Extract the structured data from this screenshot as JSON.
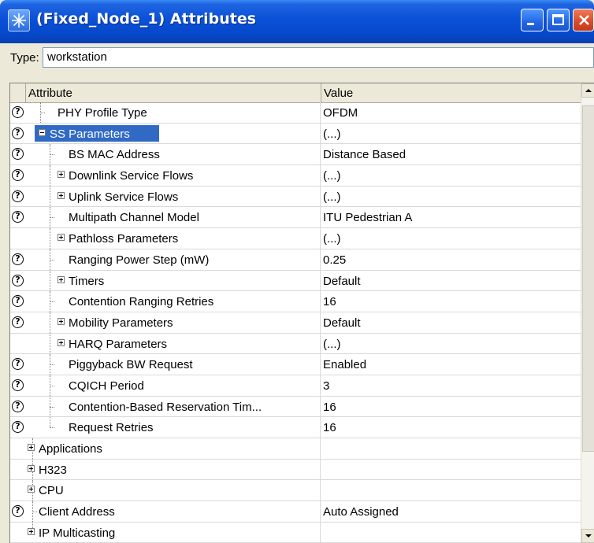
{
  "window": {
    "title": "(Fixed_Node_1) Attributes"
  },
  "type": {
    "label": "Type:",
    "value": "workstation"
  },
  "table": {
    "columns": [
      "Attribute",
      "Value"
    ],
    "rows": [
      {
        "attr": "PHY Profile Type",
        "value": "OFDM",
        "help": true,
        "level": 1,
        "expander": "none"
      },
      {
        "attr": "SS Parameters",
        "value": "(...)",
        "help": true,
        "level": 0,
        "expander": "minus",
        "selected": true
      },
      {
        "attr": "BS MAC Address",
        "value": "Distance Based",
        "help": true,
        "level": 2,
        "expander": "none"
      },
      {
        "attr": "Downlink Service Flows",
        "value": "(...)",
        "help": true,
        "level": 2,
        "expander": "plus"
      },
      {
        "attr": "Uplink Service Flows",
        "value": "(...)",
        "help": true,
        "level": 2,
        "expander": "plus"
      },
      {
        "attr": "Multipath Channel Model",
        "value": "ITU Pedestrian A",
        "help": true,
        "level": 2,
        "expander": "none"
      },
      {
        "attr": "Pathloss Parameters",
        "value": "(...)",
        "help": false,
        "level": 2,
        "expander": "plus"
      },
      {
        "attr": "Ranging Power Step (mW)",
        "value": "0.25",
        "help": true,
        "level": 2,
        "expander": "none"
      },
      {
        "attr": "Timers",
        "value": "Default",
        "help": true,
        "level": 2,
        "expander": "plus"
      },
      {
        "attr": "Contention Ranging Retries",
        "value": "16",
        "help": true,
        "level": 2,
        "expander": "none"
      },
      {
        "attr": "Mobility Parameters",
        "value": "Default",
        "help": true,
        "level": 2,
        "expander": "plus"
      },
      {
        "attr": "HARQ Parameters",
        "value": "(...)",
        "help": false,
        "level": 2,
        "expander": "plus"
      },
      {
        "attr": "Piggyback BW Request",
        "value": "Enabled",
        "help": true,
        "level": 2,
        "expander": "none"
      },
      {
        "attr": "CQICH Period",
        "value": "3",
        "help": true,
        "level": 2,
        "expander": "none"
      },
      {
        "attr": "Contention-Based Reservation Tim...",
        "value": "16",
        "help": true,
        "level": 2,
        "expander": "none"
      },
      {
        "attr": "Request Retries",
        "value": "16",
        "help": true,
        "level": 2,
        "expander": "none"
      },
      {
        "attr": "Applications",
        "value": "",
        "help": false,
        "level": -1,
        "expander": "plus"
      },
      {
        "attr": "H323",
        "value": "",
        "help": false,
        "level": -1,
        "expander": "plus"
      },
      {
        "attr": "CPU",
        "value": "",
        "help": false,
        "level": -1,
        "expander": "plus"
      },
      {
        "attr": "Client Address",
        "value": "Auto Assigned",
        "help": true,
        "level": -1,
        "expander": "none"
      },
      {
        "attr": "IP Multicasting",
        "value": "",
        "help": false,
        "level": -1,
        "expander": "plus"
      }
    ]
  },
  "icons": {
    "help": "question-circle-icon",
    "expand": "plus-box-icon",
    "collapse": "minus-box-icon"
  }
}
